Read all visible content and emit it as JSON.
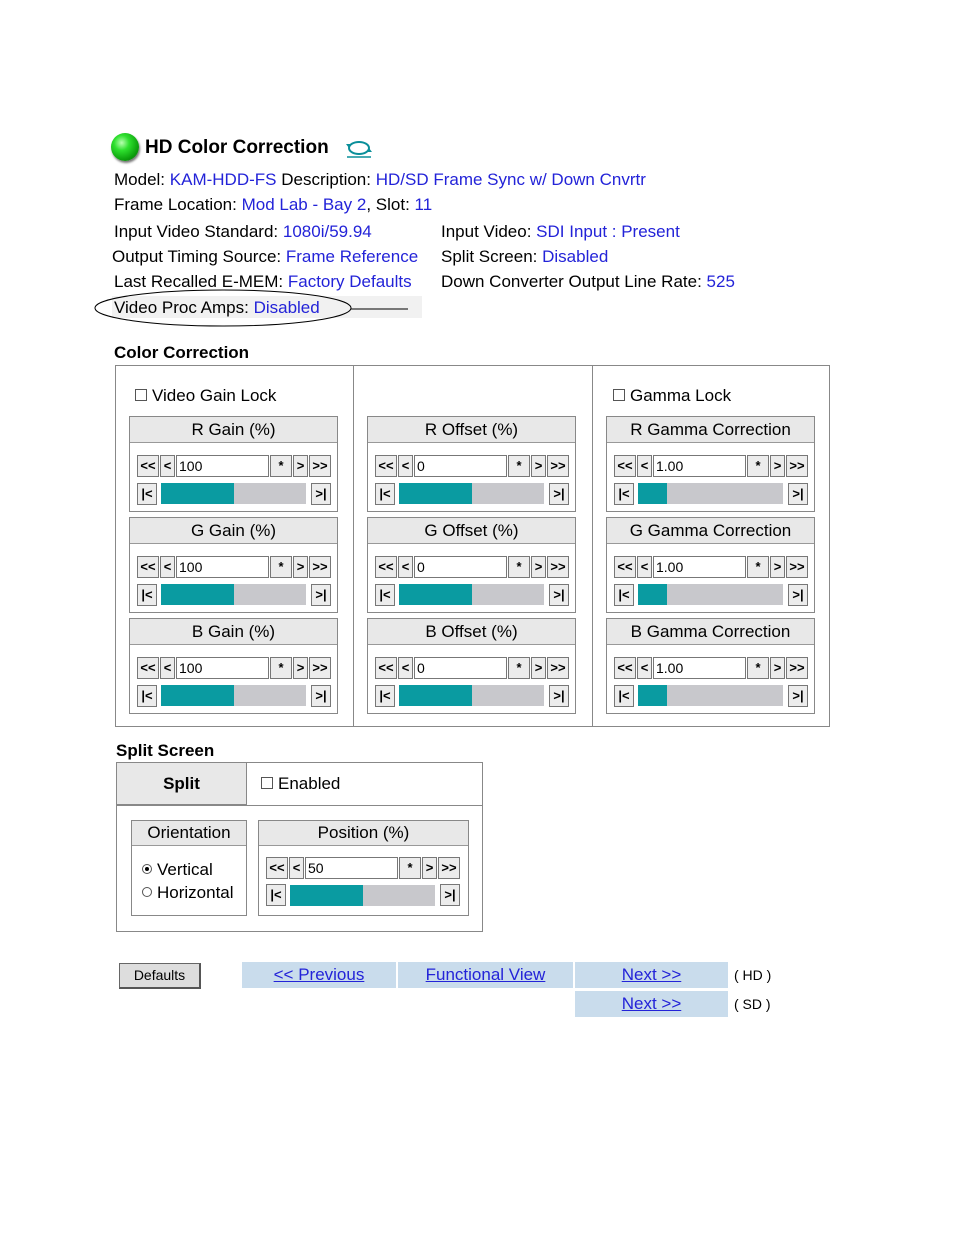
{
  "header": {
    "title": "HD Color Correction",
    "status_color": "#2ee02e"
  },
  "info": {
    "model_label": "Model:",
    "model_value": "KAM-HDD-FS",
    "description_label": "Description:",
    "description_value": "HD/SD Frame Sync w/ Down Cnvrtr",
    "frame_location_label": "Frame Location:",
    "frame_location_value": "Mod Lab - Bay 2",
    "slot_label": ", Slot:",
    "slot_value": "11",
    "input_video_standard_label": "Input Video Standard:",
    "input_video_standard_value": "1080i/59.94",
    "input_video_label": "Input Video:",
    "input_video_value": "SDI Input : Present",
    "output_timing_label": "Output Timing Source:",
    "output_timing_value": "Frame Reference",
    "split_screen_label": "Split Screen:",
    "split_screen_value": "Disabled",
    "last_recalled_label": "Last Recalled E-MEM:",
    "last_recalled_value": "Factory Defaults",
    "down_converter_label": "Down Converter Output Line Rate:",
    "down_converter_value": "525",
    "video_proc_label": "Video Proc Amps:",
    "video_proc_value": "Disabled"
  },
  "color_correction": {
    "section_title": "Color Correction",
    "video_gain_lock": "Video Gain Lock",
    "gamma_lock": "Gamma Lock",
    "buttons": {
      "fast_back": "<<",
      "back": "<",
      "star": "*",
      "fwd": ">",
      "fast_fwd": ">>",
      "min": "|<",
      "max": ">|"
    },
    "panels": [
      {
        "title": "R Gain (%)",
        "value": "100",
        "fill": 0.5
      },
      {
        "title": "G Gain (%)",
        "value": "100",
        "fill": 0.5
      },
      {
        "title": "B Gain (%)",
        "value": "100",
        "fill": 0.5
      },
      {
        "title": "R Offset (%)",
        "value": "0",
        "fill": 0.5
      },
      {
        "title": "G Offset (%)",
        "value": "0",
        "fill": 0.5
      },
      {
        "title": "B Offset (%)",
        "value": "0",
        "fill": 0.5
      },
      {
        "title": "R Gamma Correction",
        "value": "1.00",
        "fill": 0.2
      },
      {
        "title": "G Gamma Correction",
        "value": "1.00",
        "fill": 0.2
      },
      {
        "title": "B Gamma Correction",
        "value": "1.00",
        "fill": 0.2
      }
    ]
  },
  "split_screen": {
    "section_title": "Split Screen",
    "split_label": "Split",
    "enabled_label": "Enabled",
    "orientation_title": "Orientation",
    "vertical": "Vertical",
    "horizontal": "Horizontal",
    "position_title": "Position (%)",
    "position_value": "50",
    "position_fill": 0.5
  },
  "nav": {
    "defaults": "Defaults",
    "previous": "<< Previous",
    "functional_view": "Functional View",
    "next_hd": "Next >>",
    "hd_note": "( HD )",
    "next_sd": "Next >>",
    "sd_note": "( SD )"
  }
}
